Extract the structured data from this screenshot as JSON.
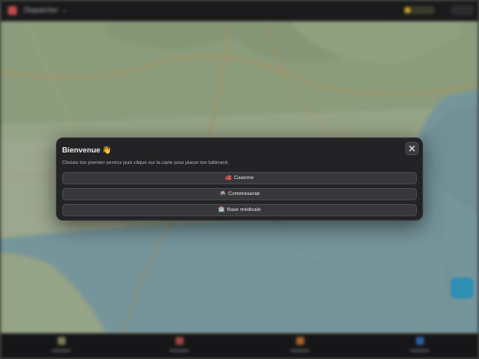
{
  "topbar": {
    "app_title": "Dispatcher",
    "coins_icon": "coin-icon"
  },
  "modal": {
    "title": "Bienvenue 👋",
    "subtitle": "Choisis ton premier service puis clique sur la carte pour placer ton bâtiment.",
    "close_icon": "close-icon",
    "options": [
      {
        "icon": "🚒",
        "label": "Caserne"
      },
      {
        "icon": "🚔",
        "label": "Commissariat"
      },
      {
        "icon": "🏥",
        "label": "Base médicale"
      }
    ]
  },
  "colors": {
    "modal_bg": "#232325",
    "option_bg": "#38383b",
    "sea": "#8fb8be",
    "land": "#b9c9a8",
    "accent_fab": "#2f8fb3"
  }
}
